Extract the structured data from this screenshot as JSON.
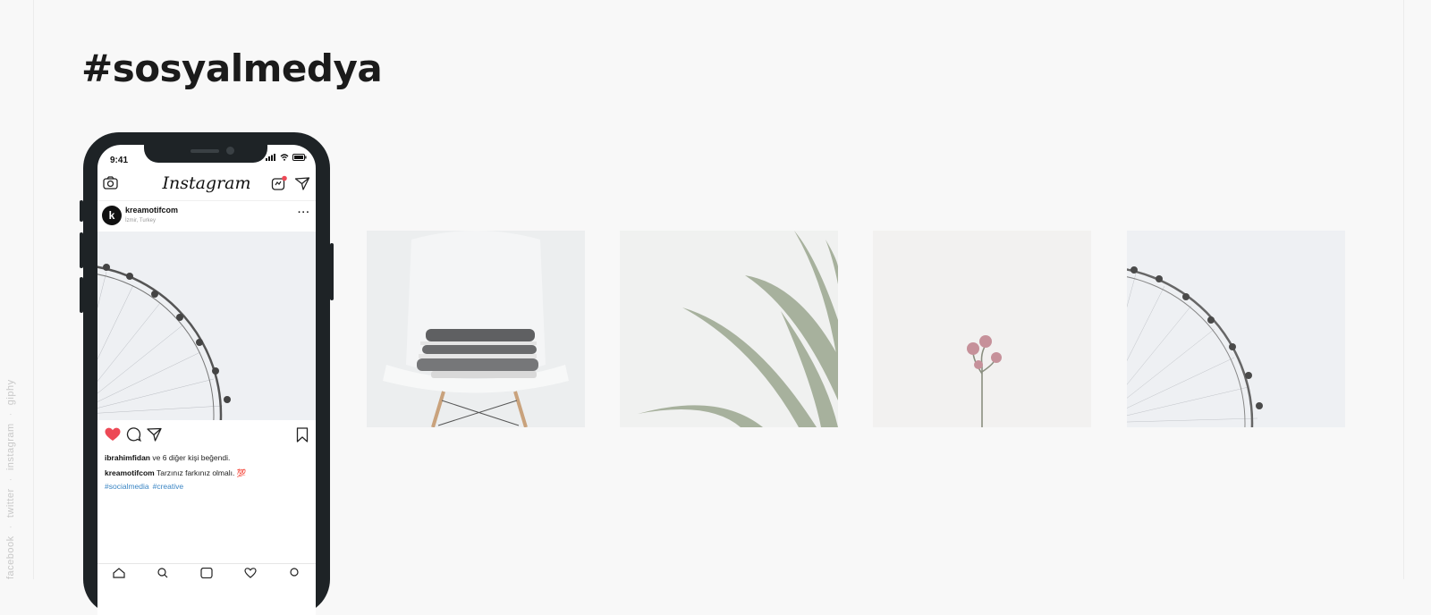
{
  "side_links": [
    "facebook",
    "twitter",
    "instagram",
    "giphy"
  ],
  "section": {
    "title": "#sosyalmedya"
  },
  "phone": {
    "status_time": "9:41",
    "app_logo": "Instagram",
    "post": {
      "username": "kreamotifcom",
      "location": "İzmir, Turkey",
      "avatar_letter": "k",
      "likes_user": "ibrahimfidan",
      "likes_text": "ve 6 diğer kişi beğendi.",
      "caption_user": "kreamotifcom",
      "caption_text": "Tarzınız farkınız olmalı. 💯",
      "hashtags": [
        "#socialmedia",
        "#creative"
      ]
    },
    "icons": {
      "top_left": "camera-icon",
      "top_right": [
        "igtv-icon",
        "direct-icon"
      ],
      "actions": [
        "heart-icon",
        "comment-icon",
        "share-icon",
        "bookmark-icon"
      ],
      "nav": [
        "home-icon",
        "search-icon",
        "add-icon",
        "activity-icon",
        "profile-icon"
      ]
    },
    "colors": {
      "heart": "#ed4956",
      "hashtag": "#3b86c4",
      "frame": "#1e2326"
    }
  },
  "gallery": [
    {
      "subject": "folded clothes on white chair"
    },
    {
      "subject": "agave plant leaves"
    },
    {
      "subject": "dried rose flowers"
    },
    {
      "subject": "ferris wheel against sky"
    }
  ]
}
